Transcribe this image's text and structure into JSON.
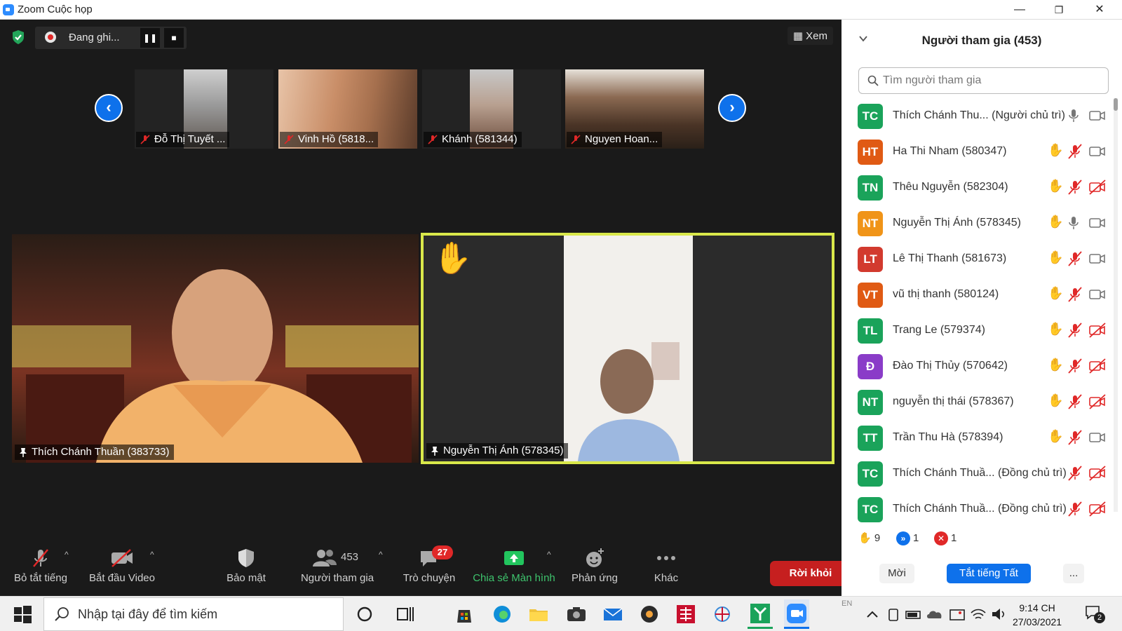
{
  "window": {
    "title": "Zoom Cuộc họp",
    "minimize": "—",
    "restore": "❐",
    "close": "✕"
  },
  "recording": {
    "label": "Đang ghi...",
    "pause": "❚❚",
    "stop": "■"
  },
  "view_button": "Xem",
  "nav": {
    "prev": "‹",
    "next": "›"
  },
  "thumbnails": [
    {
      "name": "Đỗ Thị Tuyết ..."
    },
    {
      "name": "Vinh Hồ (5818..."
    },
    {
      "name": "Khánh (581344)"
    },
    {
      "name": "Nguyen Hoan..."
    }
  ],
  "videos": {
    "left": {
      "name": "Thích Chánh Thuần (383733)"
    },
    "right": {
      "name": "Nguyễn Thị Ánh (578345)",
      "reaction": "✋"
    }
  },
  "toolbar": {
    "mute": "Bỏ tắt tiếng",
    "video": "Bắt đầu Video",
    "security": "Bảo mật",
    "participants": "Người tham gia",
    "participants_count": "453",
    "chat": "Trò chuyện",
    "chat_badge": "27",
    "share": "Chia sẻ Màn hình",
    "reactions": "Phản ứng",
    "more": "Khác",
    "leave": "Rời khỏi",
    "caret": "^"
  },
  "panel": {
    "title": "Người tham gia (453)",
    "search_placeholder": "Tìm người tham gia",
    "participants": [
      {
        "initials": "TC",
        "color": "#1aa35a",
        "name": "Thích Chánh Thu... (Người chủ trì)",
        "hand": false,
        "mic": "on",
        "video": "on"
      },
      {
        "initials": "HT",
        "color": "#e05a14",
        "name": "Ha Thi Nham (580347)",
        "hand": true,
        "mic": "off",
        "video": "on"
      },
      {
        "initials": "TN",
        "color": "#1aa35a",
        "name": "Thêu Nguyễn (582304)",
        "hand": true,
        "mic": "off",
        "video": "off"
      },
      {
        "initials": "NT",
        "color": "#f09418",
        "name": "Nguyễn Thị Ánh (578345)",
        "hand": true,
        "mic": "on",
        "video": "on"
      },
      {
        "initials": "LT",
        "color": "#d23a2e",
        "name": "Lê Thị Thanh (581673)",
        "hand": true,
        "mic": "off",
        "video": "on"
      },
      {
        "initials": "VT",
        "color": "#e05a14",
        "name": "vũ thị thanh (580124)",
        "hand": true,
        "mic": "off",
        "video": "on"
      },
      {
        "initials": "TL",
        "color": "#1aa35a",
        "name": "Trang Le (579374)",
        "hand": true,
        "mic": "off",
        "video": "off"
      },
      {
        "initials": "Đ",
        "color": "#8a3cc8",
        "name": "Đào Thị Thủy (570642)",
        "hand": true,
        "mic": "off",
        "video": "off"
      },
      {
        "initials": "NT",
        "color": "#1aa35a",
        "name": "nguyễn thị thái (578367)",
        "hand": true,
        "mic": "off",
        "video": "off"
      },
      {
        "initials": "TT",
        "color": "#1aa35a",
        "name": "Trần Thu Hà (578394)",
        "hand": true,
        "mic": "off",
        "video": "on"
      },
      {
        "initials": "TC",
        "color": "#1aa35a",
        "name": "Thích Chánh Thuầ... (Đồng chủ trì)",
        "hand": false,
        "mic": "off",
        "video": "off"
      },
      {
        "initials": "TC",
        "color": "#1aa35a",
        "name": "Thích Chánh Thuầ... (Đồng chủ trì)",
        "hand": false,
        "mic": "off",
        "video": "off"
      }
    ],
    "stats": {
      "raised_hands": "9",
      "faster": "1",
      "no": "1"
    },
    "invite": "Mời",
    "mute_all": "Tắt tiếng Tất cả",
    "more": "..."
  },
  "taskbar": {
    "search_placeholder": "Nhập tại đây để tìm kiếm",
    "language": "EN",
    "time": "9:14 CH",
    "date": "27/03/2021",
    "notification_count": "2"
  },
  "colors": {
    "accent": "#0e71eb",
    "leave": "#c61f1f",
    "share": "#22c55e",
    "speaker_border": "#d9e84a"
  }
}
